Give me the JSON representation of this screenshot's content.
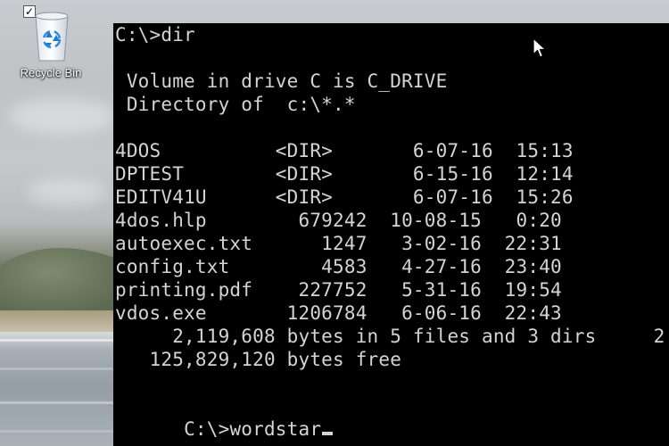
{
  "desktop": {
    "recycle_bin": {
      "label": "Recycle Bin",
      "checked": true,
      "icon": "recycle-bin-icon"
    }
  },
  "console": {
    "lines": [
      {
        "text": "C:\\>dir",
        "kind": "command"
      },
      {
        "text": "",
        "kind": "blank"
      },
      {
        "text": " Volume in drive C is C_DRIVE",
        "kind": "output"
      },
      {
        "text": " Directory of  c:\\*.*",
        "kind": "output"
      },
      {
        "text": "",
        "kind": "blank"
      },
      {
        "text": "4DOS          <DIR>       6-07-16  15:13",
        "kind": "entry"
      },
      {
        "text": "DPTEST        <DIR>       6-15-16  12:14",
        "kind": "entry"
      },
      {
        "text": "EDITV41U      <DIR>       6-07-16  15:26",
        "kind": "entry"
      },
      {
        "text": "4dos.hlp        679242  10-08-15   0:20",
        "kind": "entry"
      },
      {
        "text": "autoexec.txt      1247   3-02-16  22:31",
        "kind": "entry"
      },
      {
        "text": "config.txt        4583   4-27-16  23:40",
        "kind": "entry"
      },
      {
        "text": "printing.pdf    227752   5-31-16  19:54",
        "kind": "entry"
      },
      {
        "text": "vdos.exe       1206784   6-06-16  22:43",
        "kind": "entry"
      },
      {
        "text": "     2,119,608 bytes in 5 files and 3 dirs     2",
        "kind": "summary"
      },
      {
        "text": "   125,829,120 bytes free",
        "kind": "summary"
      },
      {
        "text": "",
        "kind": "blank"
      }
    ],
    "prompt": "C:\\>",
    "current_input": "wordstar",
    "colors": {
      "background": "#000000",
      "text": "#d4d4d4"
    }
  },
  "pointer": {
    "icon": "mouse-pointer-icon"
  }
}
